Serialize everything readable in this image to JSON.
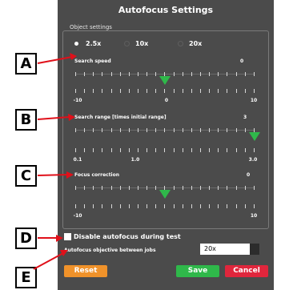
{
  "dialog": {
    "title": "Autofocus Settings"
  },
  "object_settings": {
    "group_label": "Object settings",
    "options": [
      {
        "label": "2.5x",
        "selected": true
      },
      {
        "label": "10x",
        "selected": false
      },
      {
        "label": "20x",
        "selected": false
      }
    ]
  },
  "search_speed": {
    "label": "Search speed",
    "value": "0",
    "min_label": "-10",
    "mid_label": "0",
    "max_label": "10",
    "min": -10,
    "max": 10,
    "current": 0
  },
  "search_range": {
    "label": "Search range [times initial range]",
    "value": "3",
    "min_label": "0.1",
    "mid_label": "1.0",
    "max_label": "3.0",
    "min": 0.1,
    "max": 3.0,
    "current": 3.0
  },
  "focus_correction": {
    "label": "Focus correction",
    "value": "0",
    "min_label": "-10",
    "mid_label": "0",
    "max_label": "10",
    "min": -10,
    "max": 10,
    "current": 0
  },
  "disable_autofocus": {
    "label": "Disable autofocus during test",
    "checked": false
  },
  "autofocus_objective": {
    "label": "Autofocus objective between jobs",
    "value": "20x"
  },
  "buttons": {
    "reset": "Reset",
    "save": "Save",
    "cancel": "Cancel"
  },
  "annotations": [
    "A",
    "B",
    "C",
    "D",
    "E"
  ],
  "colors": {
    "panel_bg": "#4b4b4b",
    "thumb": "#2fb84a",
    "reset": "#f0922a",
    "save": "#2fb84a",
    "cancel": "#e0263c",
    "arrow": "#e0101a"
  }
}
